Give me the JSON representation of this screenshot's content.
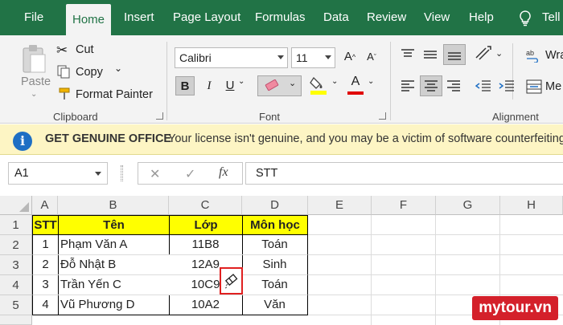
{
  "tabs": [
    "File",
    "Home",
    "Insert",
    "Page Layout",
    "Formulas",
    "Data",
    "Review",
    "View",
    "Help",
    "Tell"
  ],
  "clipboard": {
    "paste": "Paste",
    "cut": "Cut",
    "copy": "Copy",
    "format_painter": "Format Painter",
    "label": "Clipboard"
  },
  "font": {
    "name": "Calibri",
    "size": "11",
    "bold": "B",
    "italic": "I",
    "underline": "U",
    "grow": "A",
    "shrink": "A",
    "font_color_glyph": "A",
    "label": "Font",
    "fill_color": "#ffff00",
    "text_color": "#e00000"
  },
  "alignment": {
    "wrap": "Wra",
    "merge": "Me",
    "label": "Alignment"
  },
  "warning": {
    "title": "GET GENUINE OFFICE",
    "message": "Your license isn't genuine, and you may be a victim of software counterfeiting"
  },
  "formula_bar": {
    "name_box": "A1",
    "cancel": "✕",
    "enter": "✓",
    "fx": "fx",
    "formula": "STT"
  },
  "sheet": {
    "columns": [
      "A",
      "B",
      "C",
      "D",
      "E",
      "F",
      "G",
      "H"
    ],
    "rows": [
      "1",
      "2",
      "3",
      "4",
      "5"
    ],
    "header": [
      "STT",
      "Tên",
      "Lớp",
      "Môn học"
    ],
    "data": [
      [
        "1",
        "Phạm Văn A",
        "11B8",
        "Toán"
      ],
      [
        "2",
        "Đỗ Nhật B",
        "12A9",
        "Sinh"
      ],
      [
        "3",
        "Trần Yến C",
        "10C9",
        "Toán"
      ],
      [
        "4",
        "Vũ Phương D",
        "10A2",
        "Văn"
      ]
    ]
  },
  "watermark": "mytour.vn",
  "colors": {
    "accent": "#217346",
    "header_fill": "#ffff00",
    "warning_bg": "#fdf5c4",
    "info_icon": "#1e6fc4",
    "eraser_highlight": "#e02020"
  }
}
